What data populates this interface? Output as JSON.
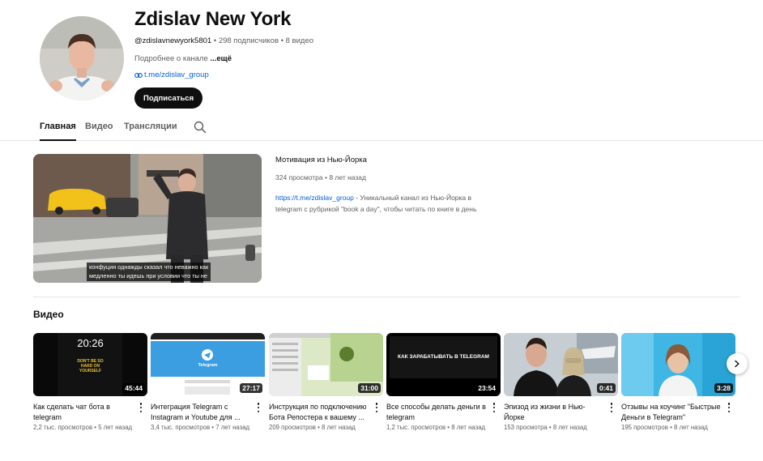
{
  "channel": {
    "name": "Zdislav New York",
    "handle": "@zdislavnewyork5801",
    "subscribers": "298 подписчиков",
    "videos_count": "8 видео",
    "separator": "•",
    "about": "Подробнее о канале",
    "about_more": "...ещё",
    "link": "t.me/zdislav_group",
    "subscribe_label": "Подписаться"
  },
  "tabs": [
    {
      "label": "Главная",
      "active": true
    },
    {
      "label": "Видео",
      "active": false
    },
    {
      "label": "Трансляции",
      "active": false
    }
  ],
  "search_icon": "search-icon",
  "featured": {
    "title": "Мотивация из Нью-Йорка",
    "views": "324 просмотра",
    "age": "8 лет назад",
    "desc_link": "https://t.me/zdislav_group",
    "desc_text": " - Уникальный канал из Нью-Йорка в telegram с рубрикой \"book a day\", чтобы читать по книге в день",
    "caption_line1": "конфуция однажды сказал что неважно как",
    "caption_line2": "медленно ты идешь при условии что ты не"
  },
  "videos_section": {
    "title": "Видео",
    "items": [
      {
        "title": "Как сделать чат бота в telegram",
        "duration": "45:44",
        "views": "2,2 тыс. просмотров",
        "age": "5 лет назад",
        "thumb_text": "20:26",
        "thumb_sub": "DON'T BE SO HARD ON YOURSELF"
      },
      {
        "title": "Интеграция Telegram с Instagram и Youtube для ...",
        "duration": "27:17",
        "views": "3,4 тыс. просмотров",
        "age": "7 лет назад",
        "thumb_text": "Telegram"
      },
      {
        "title": "Инструкция по подключению Бота Репостера к вашему ...",
        "duration": "31:00",
        "views": "209 просмотров",
        "age": "8 лет назад"
      },
      {
        "title": "Все способы делать деньги в telegram",
        "duration": "23:54",
        "views": "1,2 тыс. просмотров",
        "age": "8 лет назад",
        "thumb_text": "КАК ЗАРАБАТЫВАТЬ В TELEGRAM"
      },
      {
        "title": "Эпизод из жизни в Нью-Йорке",
        "duration": "0:41",
        "views": "153 просмотра",
        "age": "8 лет назад"
      },
      {
        "title": "Отзывы на коучинг \"Быстрые Деньги в Telegram\"",
        "duration": "3:28",
        "views": "195 просмотров",
        "age": "8 лет назад"
      }
    ]
  },
  "next_icon": "chevron-right-icon",
  "colors": {
    "link": "#065fd4",
    "subscribe_bg": "#0f0f0f",
    "meta": "#606060"
  }
}
